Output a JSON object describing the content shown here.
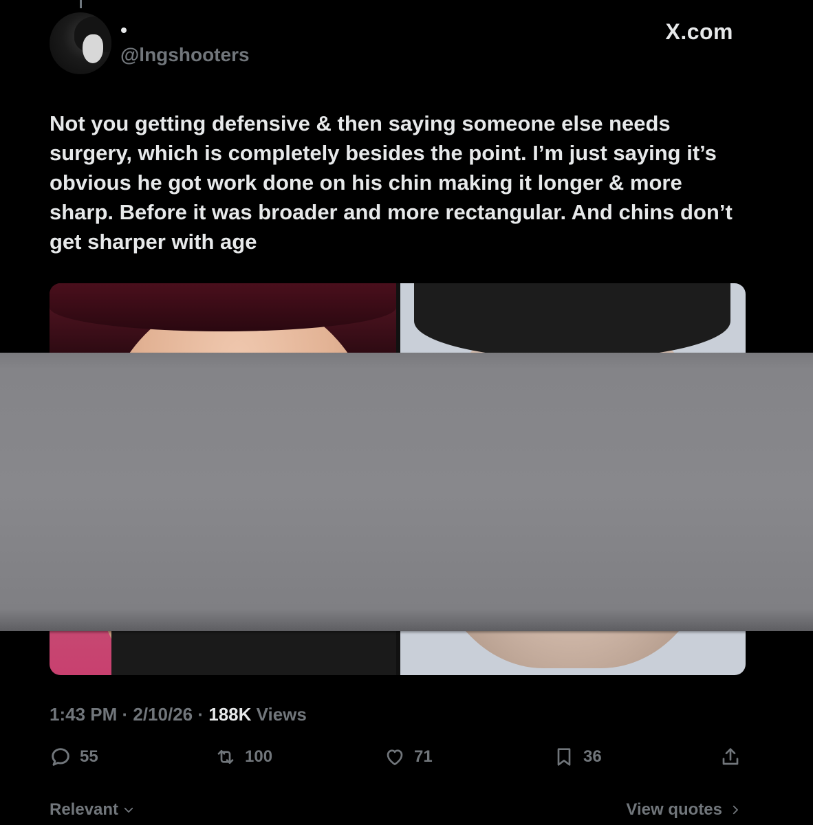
{
  "header": {
    "handle": "@lngshooters",
    "site": "X.com"
  },
  "tweet": {
    "text": "Not you getting defensive & then saying someone else needs surgery, which is completely besides the point. I’m just saying it’s obvious he got work done on his chin making it longer & more sharp. Before it was broader and more rectangular. And chins don’t get sharper with age"
  },
  "meta": {
    "time": "1:43 PM",
    "sep1": " · ",
    "date": "2/10/26",
    "sep2": " · ",
    "views_count": "188K",
    "views_label": " Views"
  },
  "actions": {
    "replies": "55",
    "reposts": "100",
    "likes": "71",
    "bookmarks": "36"
  },
  "footer": {
    "sort_label": "Relevant",
    "view_quotes": "View quotes"
  },
  "icons": {
    "reply": "reply-icon",
    "repost": "repost-icon",
    "like": "heart-icon",
    "bookmark": "bookmark-icon",
    "share": "share-icon"
  },
  "colors": {
    "background": "#000000",
    "text_primary": "#e7e9ea",
    "text_secondary": "#71767b",
    "redaction": "#88888c"
  }
}
